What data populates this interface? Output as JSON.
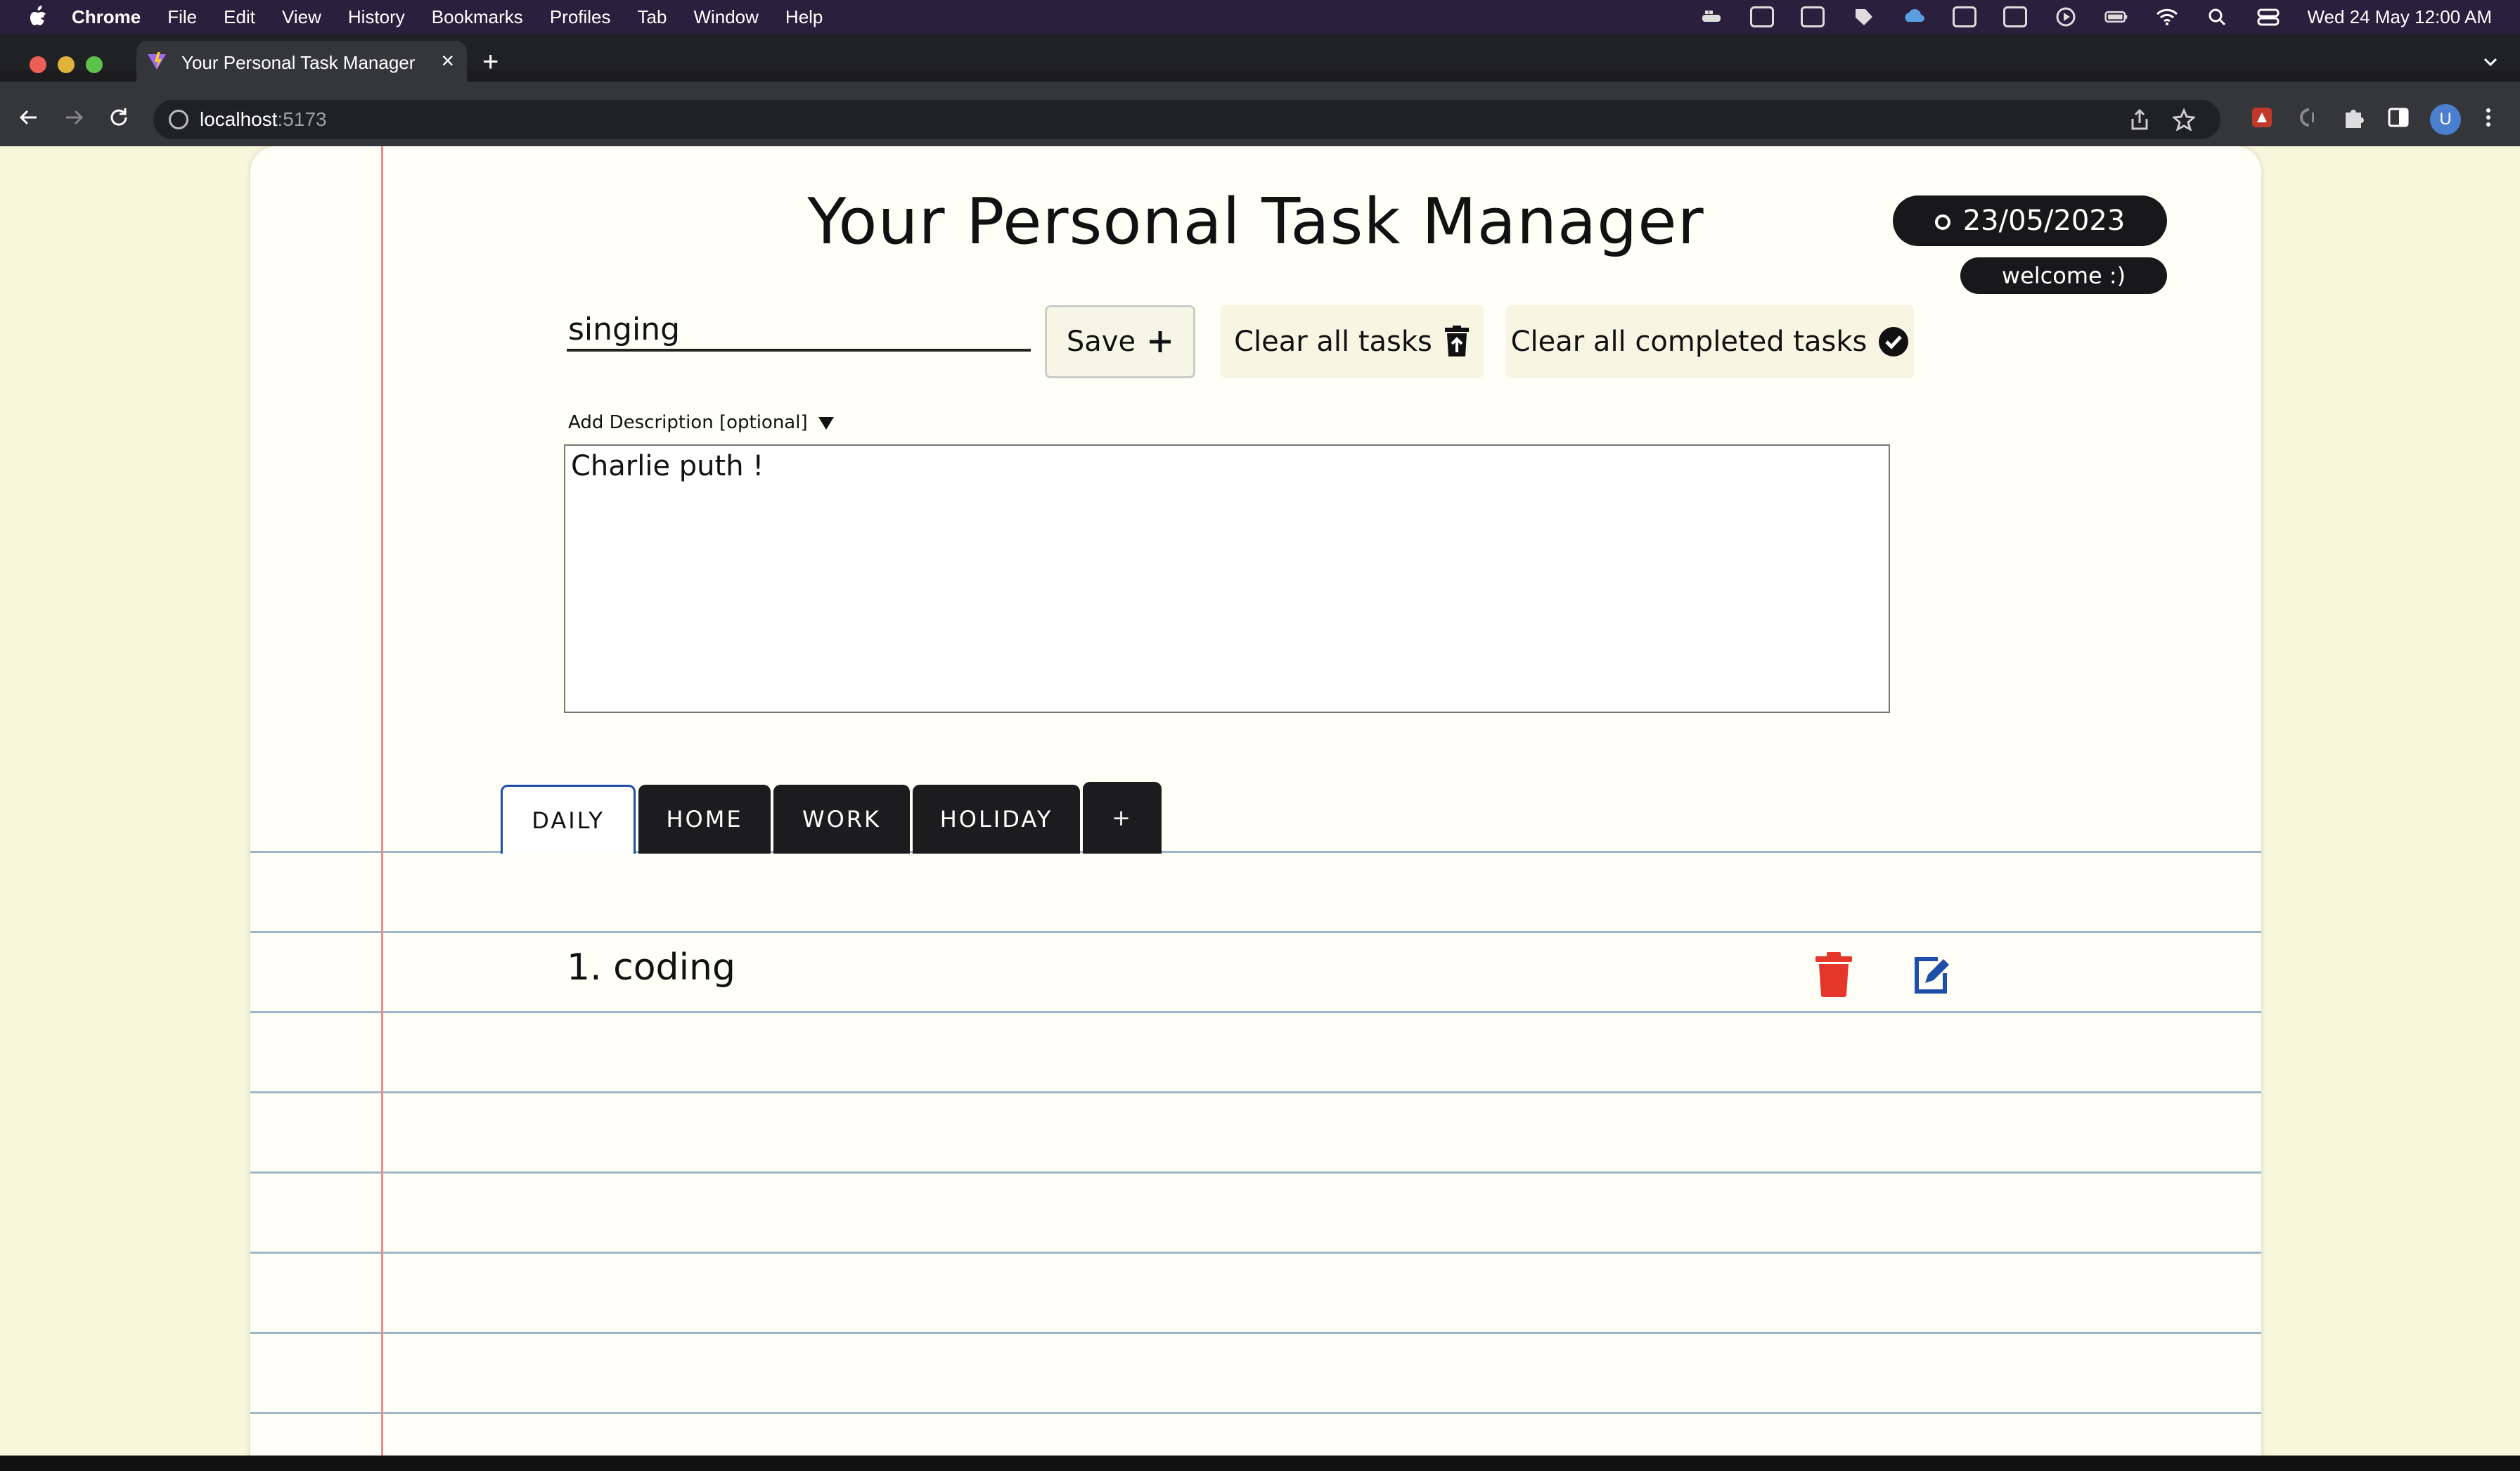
{
  "menubar": {
    "app": "Chrome",
    "items": [
      "File",
      "Edit",
      "View",
      "History",
      "Bookmarks",
      "Profiles",
      "Tab",
      "Window",
      "Help"
    ],
    "datetime": "Wed 24 May  12:00 AM"
  },
  "browser": {
    "tab_title": "Your Personal Task Manager",
    "url_host": "localhost",
    "url_port": ":5173",
    "avatar_letter": "U"
  },
  "app": {
    "title": "Your Personal Task Manager",
    "date": "23/05/2023",
    "welcome": "welcome :)",
    "task_input_value": "singing",
    "save_label": "Save",
    "clear_all_label": "Clear all tasks",
    "clear_completed_label": "Clear all completed tasks",
    "desc_label": "Add Description [optional]",
    "desc_value": "Charlie puth !",
    "tabs": [
      "DAILY",
      "HOME",
      "WORK",
      "HOLIDAY",
      "+"
    ],
    "active_tab": "DAILY",
    "tasks": [
      {
        "number": "1.",
        "text": "coding"
      }
    ]
  },
  "colors": {
    "page_bg": "#f7f7dc",
    "paper_bg": "#fffff8",
    "delete_icon": "#e5362b",
    "edit_icon": "#1d4fa8",
    "pill_bg": "#18181b"
  }
}
